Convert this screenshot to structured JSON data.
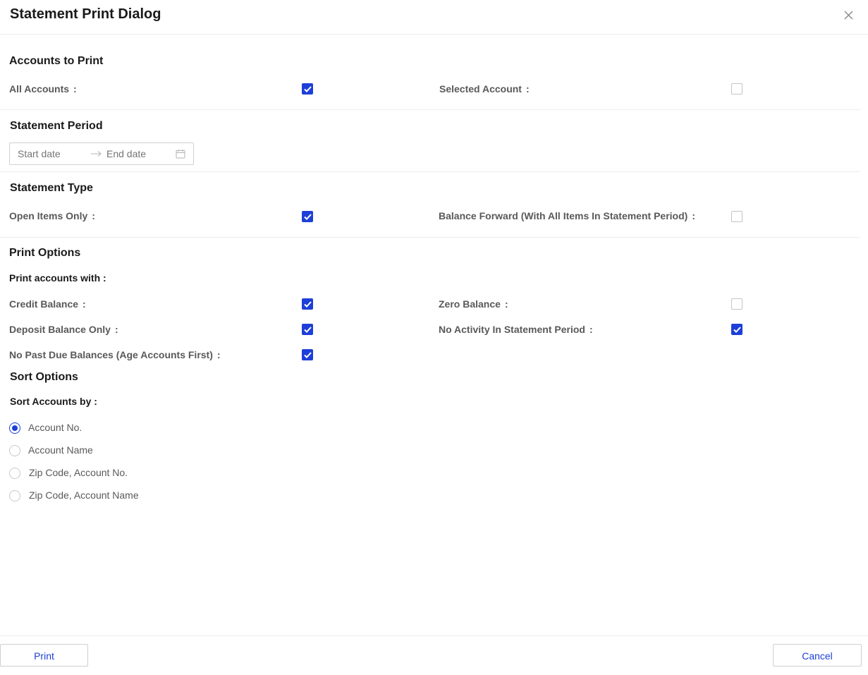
{
  "dialog": {
    "title": "Statement Print Dialog",
    "close_icon": "close-icon"
  },
  "accounts_to_print": {
    "title": "Accounts to Print",
    "all_accounts": {
      "label": "All Accounts",
      "checked": true
    },
    "selected_account": {
      "label": "Selected Account",
      "checked": false
    }
  },
  "statement_period": {
    "title": "Statement Period",
    "start_placeholder": "Start date",
    "end_placeholder": "End date",
    "arrow_icon": "arrow-right-icon",
    "calendar_icon": "calendar-icon"
  },
  "statement_type": {
    "title": "Statement Type",
    "open_items_only": {
      "label": "Open Items Only",
      "checked": true
    },
    "balance_forward": {
      "label": "Balance Forward (With All Items In Statement Period)",
      "checked": false
    }
  },
  "print_options": {
    "title": "Print Options",
    "subtitle": "Print accounts with :",
    "credit_balance": {
      "label": "Credit Balance",
      "checked": true
    },
    "zero_balance": {
      "label": "Zero Balance",
      "checked": false
    },
    "deposit_balance_only": {
      "label": "Deposit Balance Only",
      "checked": true
    },
    "no_activity": {
      "label": "No Activity In Statement Period",
      "checked": true
    },
    "no_past_due": {
      "label": "No Past Due Balances (Age Accounts First)",
      "checked": true
    }
  },
  "sort_options": {
    "title": "Sort Options",
    "subtitle": "Sort Accounts by :",
    "options": [
      {
        "label": "Account No.",
        "selected": true
      },
      {
        "label": "Account Name",
        "selected": false
      },
      {
        "label": "Zip Code, Account No.",
        "selected": false
      },
      {
        "label": "Zip Code, Account Name",
        "selected": false
      }
    ]
  },
  "footer": {
    "print_label": "Print",
    "cancel_label": "Cancel"
  },
  "colon": ":",
  "colors": {
    "accent": "#1d3fd8",
    "label": "#595959",
    "heading": "#1a1a1a",
    "border": "#d0d0d0"
  }
}
